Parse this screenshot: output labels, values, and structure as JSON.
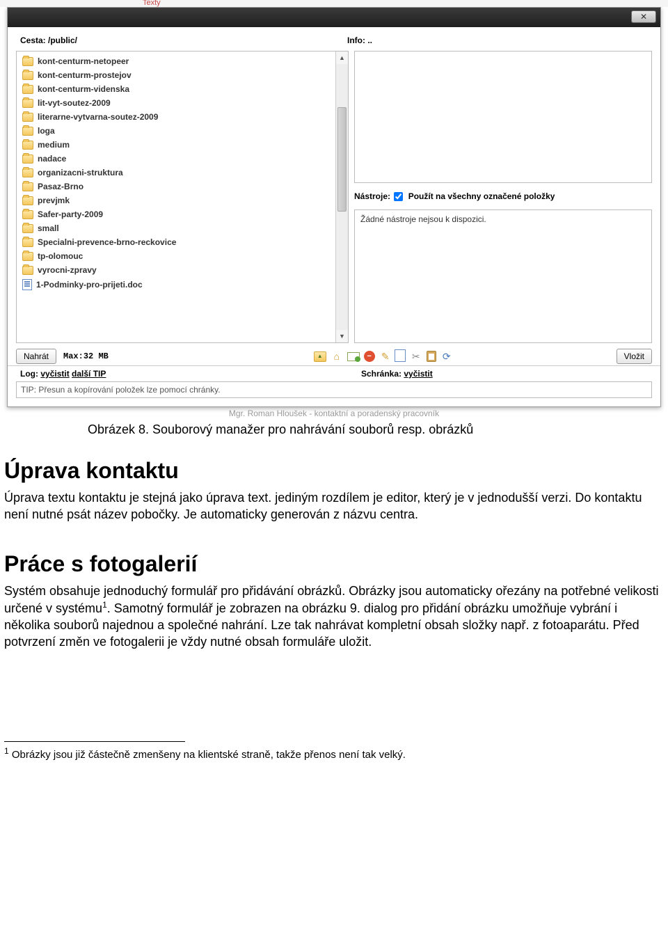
{
  "topStrip": {
    "tabLabel": "Texty"
  },
  "dialog": {
    "pathLabel": "Cesta: /public/",
    "infoLabel": "Info: ..",
    "files": [
      {
        "name": "kont-centurm-netopeer",
        "type": "folder"
      },
      {
        "name": "kont-centurm-prostejov",
        "type": "folder"
      },
      {
        "name": "kont-centurm-videnska",
        "type": "folder"
      },
      {
        "name": "lit-vyt-soutez-2009",
        "type": "folder"
      },
      {
        "name": "literarne-vytvarna-soutez-2009",
        "type": "folder"
      },
      {
        "name": "loga",
        "type": "folder"
      },
      {
        "name": "medium",
        "type": "folder"
      },
      {
        "name": "nadace",
        "type": "folder"
      },
      {
        "name": "organizacni-struktura",
        "type": "folder"
      },
      {
        "name": "Pasaz-Brno",
        "type": "folder"
      },
      {
        "name": "prevjmk",
        "type": "folder"
      },
      {
        "name": "Safer-party-2009",
        "type": "folder"
      },
      {
        "name": "small",
        "type": "folder"
      },
      {
        "name": "Specialni-prevence-brno-reckovice",
        "type": "folder"
      },
      {
        "name": "tp-olomouc",
        "type": "folder"
      },
      {
        "name": "vyrocni-zpravy",
        "type": "folder"
      },
      {
        "name": "1-Podminky-pro-prijeti.doc",
        "type": "doc"
      }
    ],
    "toolsLabel": "Nástroje:",
    "toolsCheckboxLabel": "Použít na všechny označené položky",
    "toolsEmpty": "Žádné nástroje nejsou k dispozici.",
    "uploadButton": "Nahrát",
    "maxLabel": "Max:32 MB",
    "insertButton": "Vložit",
    "logLabel": "Log:",
    "logClear": "vyčistit",
    "logMore": "další TIP",
    "clipboardLabel": "Schránka:",
    "clipboardClear": "vyčistit",
    "tip": "TIP: Přesun a kopírování položek lze pomocí chránky."
  },
  "bgLine": "Mgr. Roman Hloušek - kontaktní a poradenský pracovník",
  "doc": {
    "caption": "Obrázek 8. Souborový manažer pro nahrávání souborů resp. obrázků",
    "section1Title": "Úprava kontaktu",
    "section1Body": "Úprava textu kontaktu je stejná jako úprava text. jediným rozdílem je editor, který je v jednodušší verzi. Do kontaktu není nutné psát název pobočky. Je automaticky generován z názvu centra.",
    "section2Title": "Práce s fotogalerií",
    "section2BodyA": "Systém obsahuje jednoduchý formulář pro přidávání obrázků. Obrázky jsou automaticky ořezány na potřebné velikosti určené v systému",
    "section2BodyB": ". Samotný formulář je zobrazen na obrázku 9. dialog pro přidání obrázku umožňuje vybrání i několika souborů najednou a společné nahrání. Lze tak nahrávat kompletní obsah složky např. z fotoaparátu. Před potvrzení změn ve fotogalerii je vždy nutné obsah formuláře uložit.",
    "footnoteNum": "1",
    "footnote": " Obrázky jsou již částečně zmenšeny na klientské straně, takže přenos není tak velký."
  }
}
